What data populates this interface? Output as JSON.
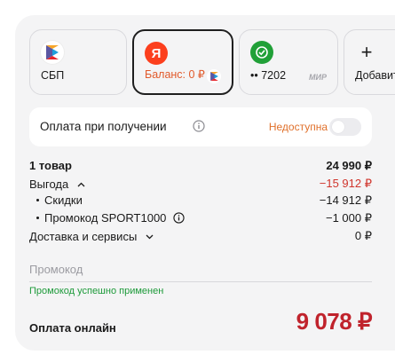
{
  "payment_methods": [
    {
      "label": "СБП",
      "icon": "sbp-logo"
    },
    {
      "label": "Баланс: 0 ₽",
      "icon": "yandex-logo",
      "selected": true,
      "badge_icon": "sbp-logo"
    },
    {
      "label": "•• 7202",
      "icon": "sber-check-logo",
      "network": "МИР"
    },
    {
      "label": "Добавить",
      "icon": "plus-icon"
    }
  ],
  "cash_on_delivery": {
    "title": "Оплата при получении",
    "status": "Недоступна",
    "enabled": false
  },
  "summary": {
    "items_label": "1 товар",
    "items_value": "24 990 ₽",
    "benefit_label": "Выгода",
    "benefit_value": "−15 912 ₽",
    "discounts_label": "Скидки",
    "discounts_value": "−14 912 ₽",
    "promo_label": "Промокод SPORT1000",
    "promo_value": "−1 000 ₽",
    "delivery_label": "Доставка и сервисы",
    "delivery_value": "0 ₽"
  },
  "promo": {
    "placeholder": "Промокод",
    "success": "Промокод успешно применен"
  },
  "payment": {
    "label": "Оплата онлайн",
    "total": "9 078 ₽"
  },
  "colors": {
    "accent_red": "#c0232c",
    "warning_orange": "#e0702b",
    "success_green": "#1d9a3a"
  }
}
